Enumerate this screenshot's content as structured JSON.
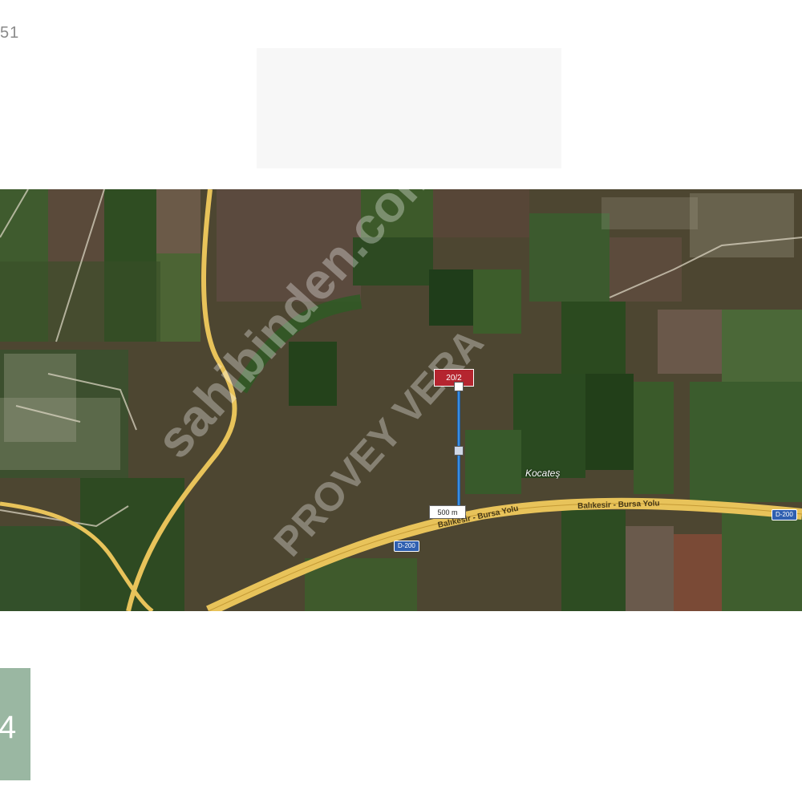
{
  "page": {
    "corner_text": "51",
    "logo_char": "4"
  },
  "map": {
    "watermark_primary": "sahibinden.com",
    "watermark_secondary": "PROVEY VERA",
    "parcel_label": "20/2",
    "distance_label": "500 m",
    "place_name": "Kocateş",
    "highway_shield": "D-200",
    "highway_shield_2": "D-200",
    "road_label_1": "Balıkesir - Bursa Yolu",
    "road_label_2": "Balıkesir - Bursa Yolu",
    "colors": {
      "road": "#e8c35a",
      "measure_line": "#3a8fe0",
      "parcel": "#b5252f",
      "logo_tile": "#9ab7a2"
    }
  }
}
